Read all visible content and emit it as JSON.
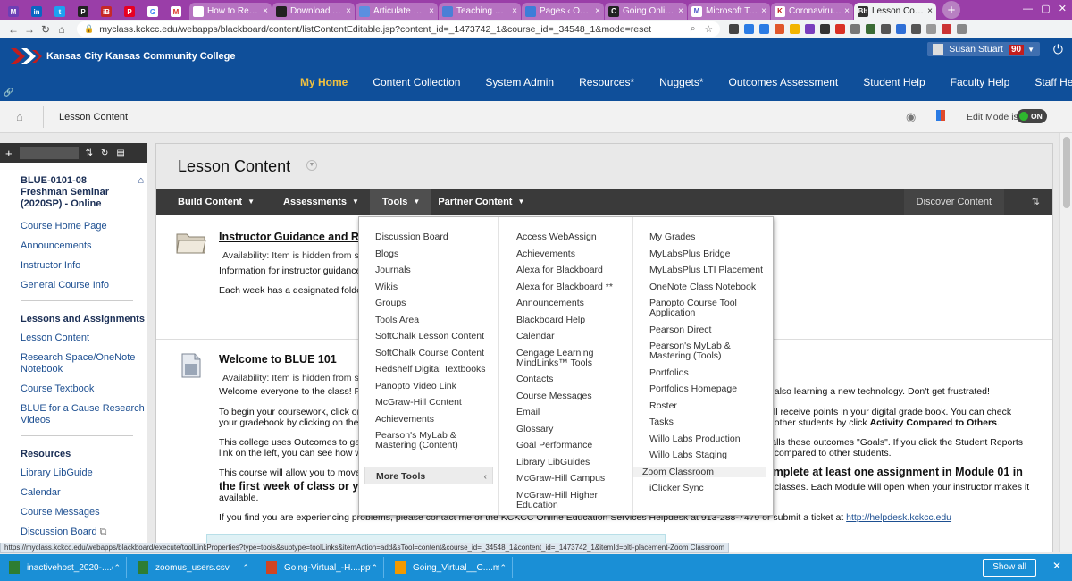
{
  "browser": {
    "pinned_tabs": [
      "M",
      "in",
      "t",
      "P",
      "iB",
      "P",
      "G",
      "M"
    ],
    "tabs": [
      {
        "title": "How to Respond"
      },
      {
        "title": "Download Article"
      },
      {
        "title": "Articulate Story"
      },
      {
        "title": "Teaching Effectiv"
      },
      {
        "title": "Pages ‹ Online E"
      },
      {
        "title": "Going Online in"
      },
      {
        "title": "Microsoft Teams"
      },
      {
        "title": "Coronavirus Upc"
      },
      {
        "title": "Lesson Content"
      }
    ],
    "new_tab": "+",
    "address": "myclass.kckcc.edu/webapps/blackboard/content/listContentEditable.jsp?content_id=_1473742_1&course_id=_34548_1&mode=reset",
    "extension_colors": [
      "#444444",
      "#2a7be4",
      "#2a7be4",
      "#e0572b",
      "#f2b400",
      "#7a3ebd",
      "#333333",
      "#d93025",
      "#777777",
      "#3a6b35",
      "#555555",
      "#2f6fd6",
      "#555555",
      "#999999",
      "#c33",
      "#888888"
    ]
  },
  "header": {
    "college_name": "Kansas City Kansas Community College",
    "user_name": "Susan Stuart",
    "notifications": "90",
    "nav": [
      {
        "label": "My Home",
        "active": true
      },
      {
        "label": "Content Collection"
      },
      {
        "label": "System Admin"
      },
      {
        "label": "Resources*"
      },
      {
        "label": "Nuggets*"
      },
      {
        "label": "Outcomes Assessment"
      },
      {
        "label": "Student Help"
      },
      {
        "label": "Faculty Help"
      },
      {
        "label": "Staff Help"
      }
    ]
  },
  "breadcrumb": {
    "current": "Lesson Content",
    "edit_mode_label": "Edit Mode is:",
    "edit_mode_state": "ON"
  },
  "course_menu": {
    "course_title": "BLUE-0101-08 Freshman Seminar (2020SP) - Online",
    "links_top": [
      "Course Home Page",
      "Announcements",
      "Instructor Info",
      "General Course Info"
    ],
    "section_lessons": "Lessons and Assignments",
    "links_lessons": [
      "Lesson Content",
      "Research Space/OneNote Notebook",
      "Course Textbook",
      "BLUE for a Cause Research Videos"
    ],
    "section_resources": "Resources",
    "links_resources": [
      "Library LibGuide",
      "Calendar",
      "Course Messages",
      "Discussion Board"
    ]
  },
  "page": {
    "title": "Lesson Content",
    "actions": {
      "build": "Build Content",
      "assess": "Assessments",
      "tools": "Tools",
      "partner": "Partner Content",
      "discover": "Discover Content"
    }
  },
  "items": {
    "item1": {
      "title": "Instructor Guidance and Re",
      "availability": "Availability:  Item is hidden from s",
      "line1": "Information for instructor guidance",
      "line2": "Each week has a designated folder"
    },
    "item2": {
      "title": "Welcome to BLUE 101",
      "availability": "Availability:  Item is hidden from s",
      "line1a": "Welcome everyone to the class!   F",
      "line1b": "d also learning a new technology. Don't get frustrated!",
      "line2a": "To begin your coursework, click on",
      "line2b": "will receive points in your digital grade book. You can check",
      "line3a": "your gradebook by clicking on the \"",
      "line3b": "o other students by click ",
      "line3c": "Activity Compared to Others",
      "line4a": "This college uses Outcomes to gau",
      "line4b": "calls these outcomes \"Goals\".  If you click the Student Reports",
      "line5a": "link on the left, you can see how w",
      "line5b": "e compared to other students.",
      "line6a": "This course will allow you to move",
      "line6b": "omplete at least one assignment in Module 01 in",
      "line7a": "the first week of class or y",
      "line7b": "e classes.  Each Module will open when your instructor makes it",
      "line8": "available.",
      "line9": "If you find you are experiencing problems, please contact me or the KCKCC Online Education Services Helpdesk at 913-288-7479 or submit a ticket at ",
      "helpdesk_link": "http://helpdesk.kckcc.edu"
    }
  },
  "tools_menu": {
    "col1": [
      "Discussion Board",
      "Blogs",
      "Journals",
      "Wikis",
      "Groups",
      "Tools Area",
      "SoftChalk Lesson Content",
      "SoftChalk Course Content",
      "Redshelf Digital Textbooks",
      "Panopto Video Link",
      "McGraw-Hill Content",
      "Achievements",
      "Pearson's MyLab & Mastering (Content)"
    ],
    "more_tools": "More Tools",
    "col2": [
      "Access WebAssign",
      "Achievements",
      "Alexa for Blackboard",
      "Alexa for Blackboard **",
      "Announcements",
      "Blackboard Help",
      "Calendar",
      "Cengage Learning MindLinks™ Tools",
      "Contacts",
      "Course Messages",
      "Email",
      "Glossary",
      "Goal Performance",
      "Library LibGuides",
      "McGraw-Hill Campus",
      "McGraw-Hill Higher Education"
    ],
    "col3": [
      "My Grades",
      "MyLabsPlus Bridge",
      "MyLabsPlus LTI Placement",
      "OneNote Class Notebook",
      "Panopto Course Tool Application",
      "Pearson Direct",
      "Pearson's MyLab & Mastering (Tools)",
      "Portfolios",
      "Portfolios Homepage",
      "Roster",
      "Tasks",
      "Willo Labs Production",
      "Willo Labs Staging",
      "Zoom Classroom",
      "iClicker Sync"
    ]
  },
  "status_url": "https://myclass.kckcc.edu/webapps/blackboard/execute/toolLinkProperties?type=tools&subtype=toolLinks&itemAction=add&sTool=content&course_id=_34548_1&content_id=_1473742_1&itemId=bltl-placement-Zoom Classroom",
  "downloads": {
    "files": [
      {
        "name": "inactivehost_2020-....csv",
        "color": "#2e7d32"
      },
      {
        "name": "zoomus_users.csv",
        "color": "#2e7d32"
      },
      {
        "name": "Going-Virtual_-H....pptx",
        "color": "#d04423"
      },
      {
        "name": "Going_Virtual__C....mp4",
        "color": "#f29900"
      }
    ],
    "show_all": "Show all"
  }
}
